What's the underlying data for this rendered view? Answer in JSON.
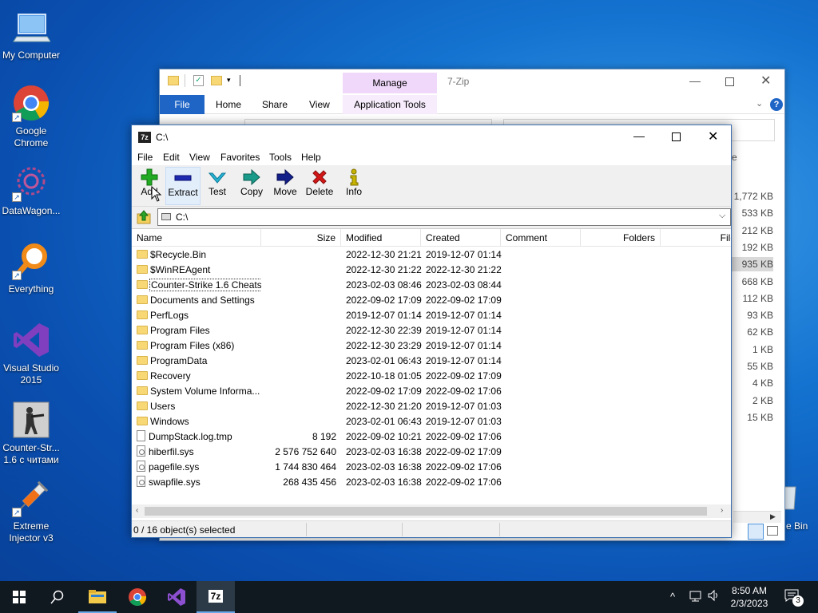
{
  "desktop": {
    "icons": [
      {
        "label": "My Computer",
        "icon": "computer-icon"
      },
      {
        "label": "Google Chrome",
        "icon": "chrome-icon"
      },
      {
        "label": "DataWagon...",
        "icon": "datawagon-icon"
      },
      {
        "label": "Everything",
        "icon": "search-magnifier-icon"
      },
      {
        "label": "Visual Studio 2015",
        "icon": "visual-studio-icon"
      },
      {
        "label": "Counter-Str... 1.6 с читами",
        "icon": "counter-strike-icon"
      },
      {
        "label": "Extreme Injector v3",
        "icon": "syringe-icon"
      }
    ],
    "recycle_bin_label": "e Bin"
  },
  "explorer": {
    "title": "7-Zip",
    "manage_tab": "Manage",
    "ribbon_tabs": [
      "File",
      "Home",
      "Share",
      "View",
      "Application Tools"
    ],
    "column_partial": "e",
    "sizes": [
      "1,772 KB",
      "533 KB",
      "212 KB",
      "192 KB",
      "935 KB",
      "668 KB",
      "112 KB",
      "93 KB",
      "62 KB",
      "1 KB",
      "55 KB",
      "4 KB",
      "2 KB",
      "15 KB"
    ]
  },
  "zip": {
    "title": "C:\\",
    "app_icon": "7z",
    "menu": [
      "File",
      "Edit",
      "View",
      "Favorites",
      "Tools",
      "Help"
    ],
    "toolbar": [
      {
        "label": "Add",
        "icon": "plus-icon",
        "color": "#1aa31a"
      },
      {
        "label": "Extract",
        "icon": "minus-icon",
        "color": "#1e1ea0"
      },
      {
        "label": "Test",
        "icon": "check-icon",
        "color": "#1a9bbb"
      },
      {
        "label": "Copy",
        "icon": "arrow-right-icon",
        "color": "#1a8a7a"
      },
      {
        "label": "Move",
        "icon": "arrow-right-icon",
        "color": "#0a1a7a"
      },
      {
        "label": "Delete",
        "icon": "x-icon",
        "color": "#d01010"
      },
      {
        "label": "Info",
        "icon": "info-icon",
        "color": "#b8a400"
      }
    ],
    "address": "C:\\",
    "columns": [
      "Name",
      "Size",
      "Modified",
      "Created",
      "Comment",
      "Folders",
      "File"
    ],
    "rows": [
      {
        "name": "$Recycle.Bin",
        "type": "folder",
        "size": "",
        "modified": "2022-12-30 21:21",
        "created": "2019-12-07 01:14"
      },
      {
        "name": "$WinREAgent",
        "type": "folder",
        "size": "",
        "modified": "2022-12-30 21:22",
        "created": "2022-12-30 21:22"
      },
      {
        "name": "Counter-Strike 1.6 Cheats",
        "type": "folder",
        "size": "",
        "modified": "2023-02-03 08:46",
        "created": "2023-02-03 08:44"
      },
      {
        "name": "Documents and Settings",
        "type": "folder",
        "size": "",
        "modified": "2022-09-02 17:09",
        "created": "2022-09-02 17:09"
      },
      {
        "name": "PerfLogs",
        "type": "folder",
        "size": "",
        "modified": "2019-12-07 01:14",
        "created": "2019-12-07 01:14"
      },
      {
        "name": "Program Files",
        "type": "folder",
        "size": "",
        "modified": "2022-12-30 22:39",
        "created": "2019-12-07 01:14"
      },
      {
        "name": "Program Files (x86)",
        "type": "folder",
        "size": "",
        "modified": "2022-12-30 23:29",
        "created": "2019-12-07 01:14"
      },
      {
        "name": "ProgramData",
        "type": "folder",
        "size": "",
        "modified": "2023-02-01 06:43",
        "created": "2019-12-07 01:14"
      },
      {
        "name": "Recovery",
        "type": "folder",
        "size": "",
        "modified": "2022-10-18 01:05",
        "created": "2022-09-02 17:09"
      },
      {
        "name": "System Volume Informa...",
        "type": "folder",
        "size": "",
        "modified": "2022-09-02 17:09",
        "created": "2022-09-02 17:06"
      },
      {
        "name": "Users",
        "type": "folder",
        "size": "",
        "modified": "2022-12-30 21:20",
        "created": "2019-12-07 01:03"
      },
      {
        "name": "Windows",
        "type": "folder",
        "size": "",
        "modified": "2023-02-01 06:43",
        "created": "2019-12-07 01:03"
      },
      {
        "name": "DumpStack.log.tmp",
        "type": "file",
        "size": "8 192",
        "modified": "2022-09-02 10:21",
        "created": "2022-09-02 17:06"
      },
      {
        "name": "hiberfil.sys",
        "type": "sys",
        "size": "2 576 752 640",
        "modified": "2023-02-03 16:38",
        "created": "2022-09-02 17:09"
      },
      {
        "name": "pagefile.sys",
        "type": "sys",
        "size": "1 744 830 464",
        "modified": "2023-02-03 16:38",
        "created": "2022-09-02 17:06"
      },
      {
        "name": "swapfile.sys",
        "type": "sys",
        "size": "268 435 456",
        "modified": "2023-02-03 16:38",
        "created": "2022-09-02 17:06"
      }
    ],
    "status": "0 / 16 object(s) selected"
  },
  "taskbar": {
    "time": "8:50 AM",
    "date": "2/3/2023",
    "notification_count": "3",
    "zip_label": "7z"
  }
}
